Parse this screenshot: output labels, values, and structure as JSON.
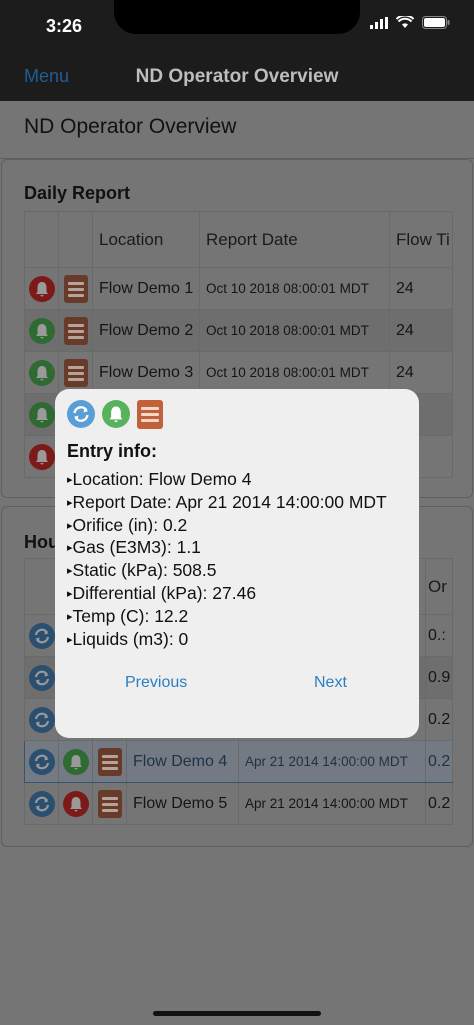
{
  "status": {
    "time": "3:26"
  },
  "nav": {
    "menu_label": "Menu",
    "title": "ND Operator Overview"
  },
  "page": {
    "title": "ND Operator Overview"
  },
  "daily": {
    "title": "Daily Report",
    "columns": [
      "Location",
      "Report Date",
      "Flow Ti"
    ],
    "rows": [
      {
        "status_icon": "bell-icon",
        "status_color": "red",
        "location": "Flow Demo 1",
        "date": "Oct 10 2018 08:00:01 MDT",
        "flow": "24"
      },
      {
        "status_icon": "bell-icon",
        "status_color": "green",
        "location": "Flow Demo 2",
        "date": "Oct 10 2018 08:00:01 MDT",
        "flow": "24"
      },
      {
        "status_icon": "bell-icon",
        "status_color": "green",
        "location": "Flow Demo 3",
        "date": "Oct 10 2018 08:00:01 MDT",
        "flow": "24"
      },
      {
        "status_icon": "bell-icon",
        "status_color": "green",
        "location": "",
        "date": "",
        "flow": ""
      },
      {
        "status_icon": "bell-icon",
        "status_color": "red",
        "location": "",
        "date": "",
        "flow": ""
      }
    ]
  },
  "hourly": {
    "title": "Hou",
    "columns": [
      "Or"
    ],
    "rows": [
      {
        "location": "",
        "date": "",
        "val": "0.:"
      },
      {
        "location": "",
        "date": "",
        "val": "0.9"
      },
      {
        "location": "",
        "date": "",
        "val": "0.2"
      },
      {
        "location": "Flow Demo 4",
        "date": "Apr 21 2014 14:00:00 MDT",
        "val": "0.2",
        "selected": true
      },
      {
        "location": "Flow Demo 5",
        "date": "Apr 21 2014 14:00:00 MDT",
        "val": "0.2"
      }
    ]
  },
  "dialog": {
    "heading": "Entry info:",
    "icons": [
      "refresh-icon",
      "bell-icon",
      "book-icon"
    ],
    "items": [
      "Location: Flow Demo 4",
      "Report Date: Apr 21 2014 14:00:00 MDT",
      "Orifice (in): 0.2",
      "Gas (E3M3): 1.1",
      "Static (kPa): 508.5",
      "Differential (kPa): 27.46",
      "Temp (C): 12.2",
      "Liquids (m3): 0"
    ],
    "previous_label": "Previous",
    "next_label": "Next"
  },
  "colors": {
    "accent": "#2a7fc3",
    "green": "#56b25d",
    "red": "#c0392b",
    "blue": "#5a9ed6",
    "book": "#c0613c"
  }
}
